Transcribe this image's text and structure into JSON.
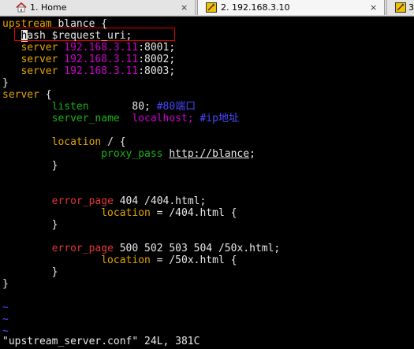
{
  "tabs": [
    {
      "label": "1. Home"
    },
    {
      "label": "2. 192.168.3.10"
    },
    {
      "label": "3"
    }
  ],
  "tab_close_glyph": "×",
  "editor": {
    "l1": {
      "a": "upstream",
      "b": " blance {"
    },
    "l2": {
      "a": "h",
      "b": "ash $request_uri;"
    },
    "l3": {
      "a": "server ",
      "b": "192.168.3.11",
      "c": ":8001;"
    },
    "l4": {
      "a": "server ",
      "b": "192.168.3.11",
      "c": ":8002;"
    },
    "l5": {
      "a": "server ",
      "b": "192.168.3.11",
      "c": ":8003;"
    },
    "l6": "}",
    "l7": {
      "a": "server",
      "b": " {"
    },
    "l8": {
      "a": "listen",
      "b": "       80; ",
      "c": "#80端口"
    },
    "l9": {
      "a": "server_name",
      "b": "  localhost;",
      "c": " #ip地址"
    },
    "l10": {
      "a": "location",
      "b": " / {"
    },
    "l11": {
      "a": "proxy_pass",
      "b": "http://blance",
      "c": ";"
    },
    "l12": "}",
    "l13": {
      "a": "error_page",
      "b": " 404 /404.html;"
    },
    "l14": {
      "a": "location",
      "b": " = /404.html {"
    },
    "l15": "}",
    "l16": {
      "a": "error_page",
      "b": " 500 502 503 504 /50x.html;"
    },
    "l17": {
      "a": "location",
      "b": " = /50x.html {"
    },
    "l18": "}",
    "l19": "}",
    "tilde": "~"
  },
  "status": "\"upstream_server.conf\" 24L, 381C",
  "colors": {
    "keyword_orange": "#e2a400",
    "directive_green": "#18b218",
    "error_page_red": "#e23535",
    "value_magenta": "#d000d0",
    "comment_blue": "#4848ff",
    "tilde_blue": "#5252ff",
    "highlight_border": "#e00000"
  }
}
